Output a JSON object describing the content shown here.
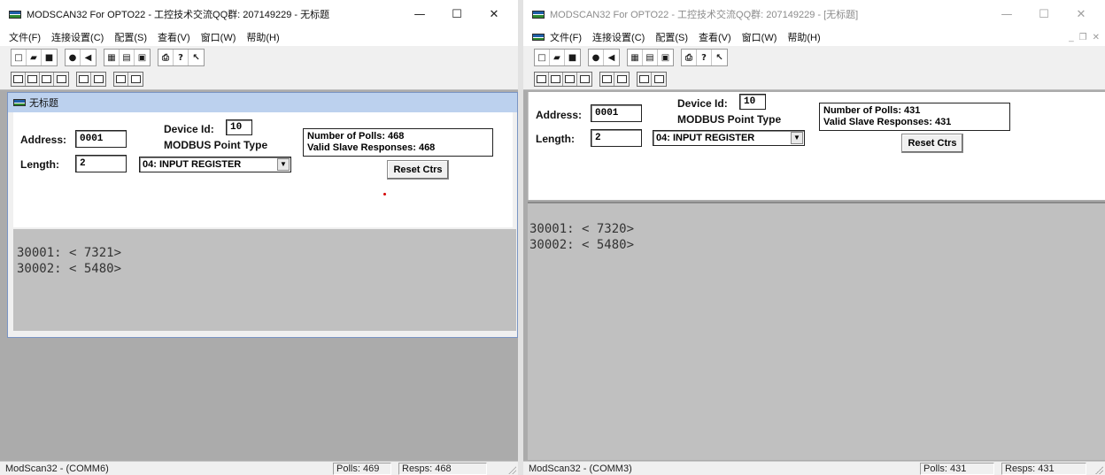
{
  "left": {
    "title": "MODSCAN32 For OPTO22 - 工控技术交流QQ群: 207149229 - 无标题",
    "menu": [
      "文件(F)",
      "连接设置(C)",
      "配置(S)",
      "查看(V)",
      "窗口(W)",
      "帮助(H)"
    ],
    "child_title": "无标题",
    "address_label": "Address:",
    "address": "0001",
    "length_label": "Length:",
    "length": "2",
    "device_id_label": "Device Id:",
    "device_id": "10",
    "point_type_label": "MODBUS Point Type",
    "point_type": "04: INPUT REGISTER",
    "polls_line": "Number of Polls: 468",
    "responses_line": "Valid Slave Responses: 468",
    "reset_label": "Reset Ctrs",
    "data_lines": [
      "30001: < 7321>",
      "30002: < 5480>"
    ],
    "status_main": "ModScan32 - (COMM6)",
    "status_polls": "Polls: 469",
    "status_resps": "Resps: 468"
  },
  "right": {
    "title": "MODSCAN32 For OPTO22 - 工控技术交流QQ群: 207149229 - [无标题]",
    "menu": [
      "文件(F)",
      "连接设置(C)",
      "配置(S)",
      "查看(V)",
      "窗口(W)",
      "帮助(H)"
    ],
    "address_label": "Address:",
    "address": "0001",
    "length_label": "Length:",
    "length": "2",
    "device_id_label": "Device Id:",
    "device_id": "10",
    "point_type_label": "MODBUS Point Type",
    "point_type": "04: INPUT REGISTER",
    "polls_line": "Number of Polls: 431",
    "responses_line": "Valid Slave Responses: 431",
    "reset_label": "Reset Ctrs",
    "data_lines": [
      "30001: < 7320>",
      "30002: < 5480>"
    ],
    "status_main": "ModScan32 - (COMM3)",
    "status_polls": "Polls: 431",
    "status_resps": "Resps: 431"
  },
  "icons": {
    "toolbar1": [
      "new-file-icon",
      "open-folder-icon",
      "save-icon",
      "connect-icon",
      "disconnect-icon",
      "display-icon",
      "setup-icon",
      "text-capture-icon",
      "print-icon",
      "help-icon",
      "context-help-icon"
    ],
    "toolbar2": [
      "binary-format-icon",
      "decimal-format-icon",
      "integer-format-icon",
      "hex-format-icon",
      "float-format-icon",
      "double-format-icon",
      "swap-format-icon",
      "long-format-icon"
    ]
  },
  "colors": {
    "data_pane": "#c0c0c0",
    "mdi_background": "#ababab",
    "child_title": "#bcd1ee"
  }
}
